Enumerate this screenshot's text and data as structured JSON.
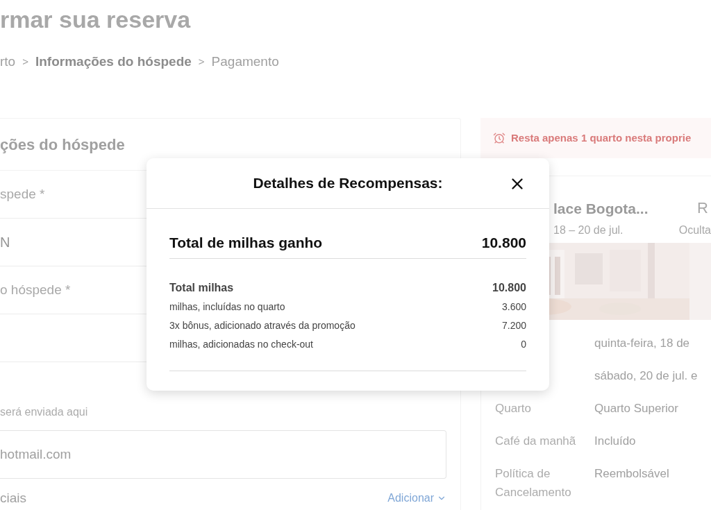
{
  "page": {
    "title": "rmar sua reserva",
    "breadcrumb": [
      {
        "kind": "step",
        "text": "rto",
        "selected": false
      },
      {
        "kind": "separator",
        "text": ">"
      },
      {
        "kind": "step",
        "text": "Informações do hóspede",
        "selected": true
      },
      {
        "kind": "separator",
        "text": ">"
      },
      {
        "kind": "step",
        "text": "Pagamento",
        "selected": false
      }
    ]
  },
  "guest_form": {
    "title": "ções do hóspede",
    "rows": [
      {
        "kind": "label",
        "text": "spede *"
      },
      {
        "kind": "value",
        "text": "N"
      },
      {
        "kind": "label",
        "text": "o hóspede *"
      },
      {
        "kind": "blank"
      }
    ],
    "email_hint": "será enviada aqui",
    "email_value": "hotmail.com",
    "special_label": "ciais",
    "special_action": "Adicionar"
  },
  "summary": {
    "alert": "Resta apenas 1 quarto nesta proprie",
    "hotel_name": "lace Bogota...",
    "hotel_side": "R",
    "dates": "18 – 20 de jul.",
    "hide_link": "Oculta",
    "details": [
      {
        "value": "quinta-feira, 18 de"
      },
      {
        "value": "sábado, 20 de jul. e"
      },
      {
        "label": "Quarto",
        "value": "Quarto Superior"
      },
      {
        "label": "Café da manhã",
        "value": "Incluído"
      },
      {
        "label": "Política de Cancelamento",
        "value": "Reembolsável"
      }
    ]
  },
  "modal": {
    "title": "Detalhes de Recompensas:",
    "total": {
      "label": "Total de milhas ganho",
      "value": "10.800"
    },
    "breakdown": [
      {
        "kind": "subtotal",
        "label": "Total milhas",
        "value": "10.800"
      },
      {
        "kind": "item",
        "label": "milhas, incluídas no quarto",
        "value": "3.600"
      },
      {
        "kind": "item",
        "label": "3x bônus, adicionado através da promoção",
        "value": "7.200"
      },
      {
        "kind": "item",
        "label": "milhas, adicionadas no check-out",
        "value": "0"
      }
    ]
  }
}
